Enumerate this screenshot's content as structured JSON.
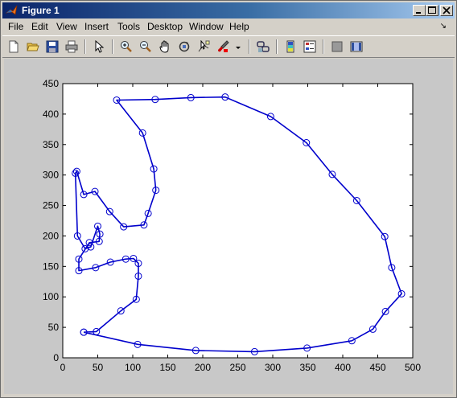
{
  "window": {
    "title": "Figure 1"
  },
  "menubar": {
    "items": [
      {
        "label": "File"
      },
      {
        "label": "Edit"
      },
      {
        "label": "View"
      },
      {
        "label": "Insert"
      },
      {
        "label": "Tools"
      },
      {
        "label": "Desktop"
      },
      {
        "label": "Window"
      },
      {
        "label": "Help"
      }
    ]
  },
  "toolbar": {
    "buttons": [
      "new-figure-icon",
      "open-file-icon",
      "save-icon",
      "print-icon",
      "edit-plot-arrow-icon",
      "zoom-in-icon",
      "zoom-out-icon",
      "pan-hand-icon",
      "rotate-3d-icon",
      "data-cursor-icon",
      "brush-icon",
      "link-plot-icon",
      "colorbar-icon",
      "legend-icon",
      "hide-plot-tools-icon",
      "show-plot-tools-icon"
    ]
  },
  "colors": {
    "line": "#0000cc",
    "axes_bg": "#ffffff",
    "figure_bg": "#c8c8c8",
    "title_bar": "#0a246a"
  },
  "chart_data": {
    "type": "line",
    "marker": "circle",
    "xlim": [
      0,
      500
    ],
    "ylim": [
      0,
      450
    ],
    "xticks": [
      0,
      50,
      100,
      150,
      200,
      250,
      300,
      350,
      400,
      450,
      500
    ],
    "yticks": [
      0,
      50,
      100,
      150,
      200,
      250,
      300,
      350,
      400,
      450
    ],
    "x": [
      30,
      48,
      83,
      105,
      108,
      108,
      101,
      90,
      68,
      47,
      23,
      23,
      38,
      52,
      53,
      50,
      40,
      32,
      21,
      18,
      20,
      30,
      46,
      67,
      87,
      116,
      122,
      133,
      130,
      114,
      77,
      132,
      183,
      232,
      297,
      348,
      385,
      420,
      460,
      470,
      484,
      461,
      443,
      413,
      349,
      274,
      190,
      107,
      30
    ],
    "y": [
      42,
      43,
      77,
      96,
      134,
      155,
      163,
      162,
      157,
      148,
      143,
      162,
      189,
      191,
      203,
      216,
      182,
      179,
      200,
      303,
      306,
      268,
      273,
      240,
      215,
      218,
      237,
      275,
      310,
      369,
      423,
      424,
      427,
      428,
      396,
      353,
      301,
      258,
      199,
      148,
      105,
      76,
      47,
      28,
      16,
      10,
      12,
      22,
      42
    ]
  }
}
